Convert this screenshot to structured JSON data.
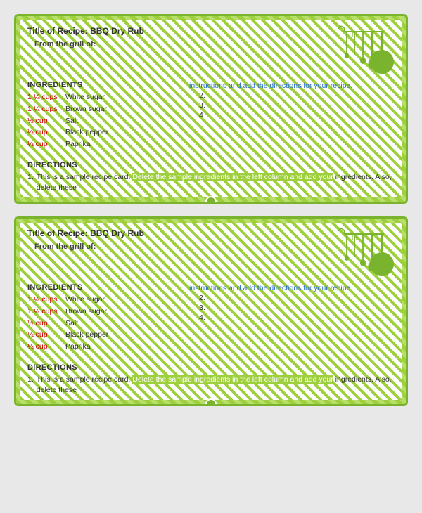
{
  "cards": [
    {
      "id": "card-1",
      "title": "Title of Recipe: BBQ Dry Rub",
      "from_label": "From the grill of:",
      "ingredients_title": "INGREDIENTS",
      "ingredients": [
        {
          "amount": "1 ¼ cups",
          "name": "White sugar"
        },
        {
          "amount": "1 ¼ cups",
          "name": "Brown sugar"
        },
        {
          "amount": "½ cup",
          "name": "Salt"
        },
        {
          "amount": "¼ cup",
          "name": "Black pepper"
        },
        {
          "amount": "¼ cup",
          "name": "Paprika"
        }
      ],
      "instructions_prompt": "instructions and add the directions for your recipe.",
      "instructions_nums": [
        "2.",
        "3.",
        "4."
      ],
      "directions_title": "DIRECTIONS",
      "direction_1_num": "1.",
      "direction_1_text": "This is a sample recipe card. Delete the sample ingredients in the left column and add your ingredients. Also, delete these"
    },
    {
      "id": "card-2",
      "title": "Title of Recipe: BBQ Dry Rub",
      "from_label": "From the grill of:",
      "ingredients_title": "INGREDIENTS",
      "ingredients": [
        {
          "amount": "1 ¼ cups",
          "name": "White sugar"
        },
        {
          "amount": "1 ¼ cups",
          "name": "Brown sugar"
        },
        {
          "amount": "½ cup",
          "name": "Salt"
        },
        {
          "amount": "¼ cup",
          "name": "Black pepper"
        },
        {
          "amount": "¼ cup",
          "name": "Paprika"
        }
      ],
      "instructions_prompt": "instructions and add the directions for your recipe.",
      "instructions_nums": [
        "2.",
        "3.",
        "4."
      ],
      "directions_title": "DIRECTIONS",
      "direction_1_num": "1.",
      "direction_1_text": "This is a sample recipe card. Delete the sample ingredients in the left column and add your ingredients. Also, delete these"
    }
  ],
  "colors": {
    "green": "#7ab32e",
    "light_green": "#9ecf3c",
    "red": "#cc0000",
    "blue": "#2a6fcc"
  }
}
